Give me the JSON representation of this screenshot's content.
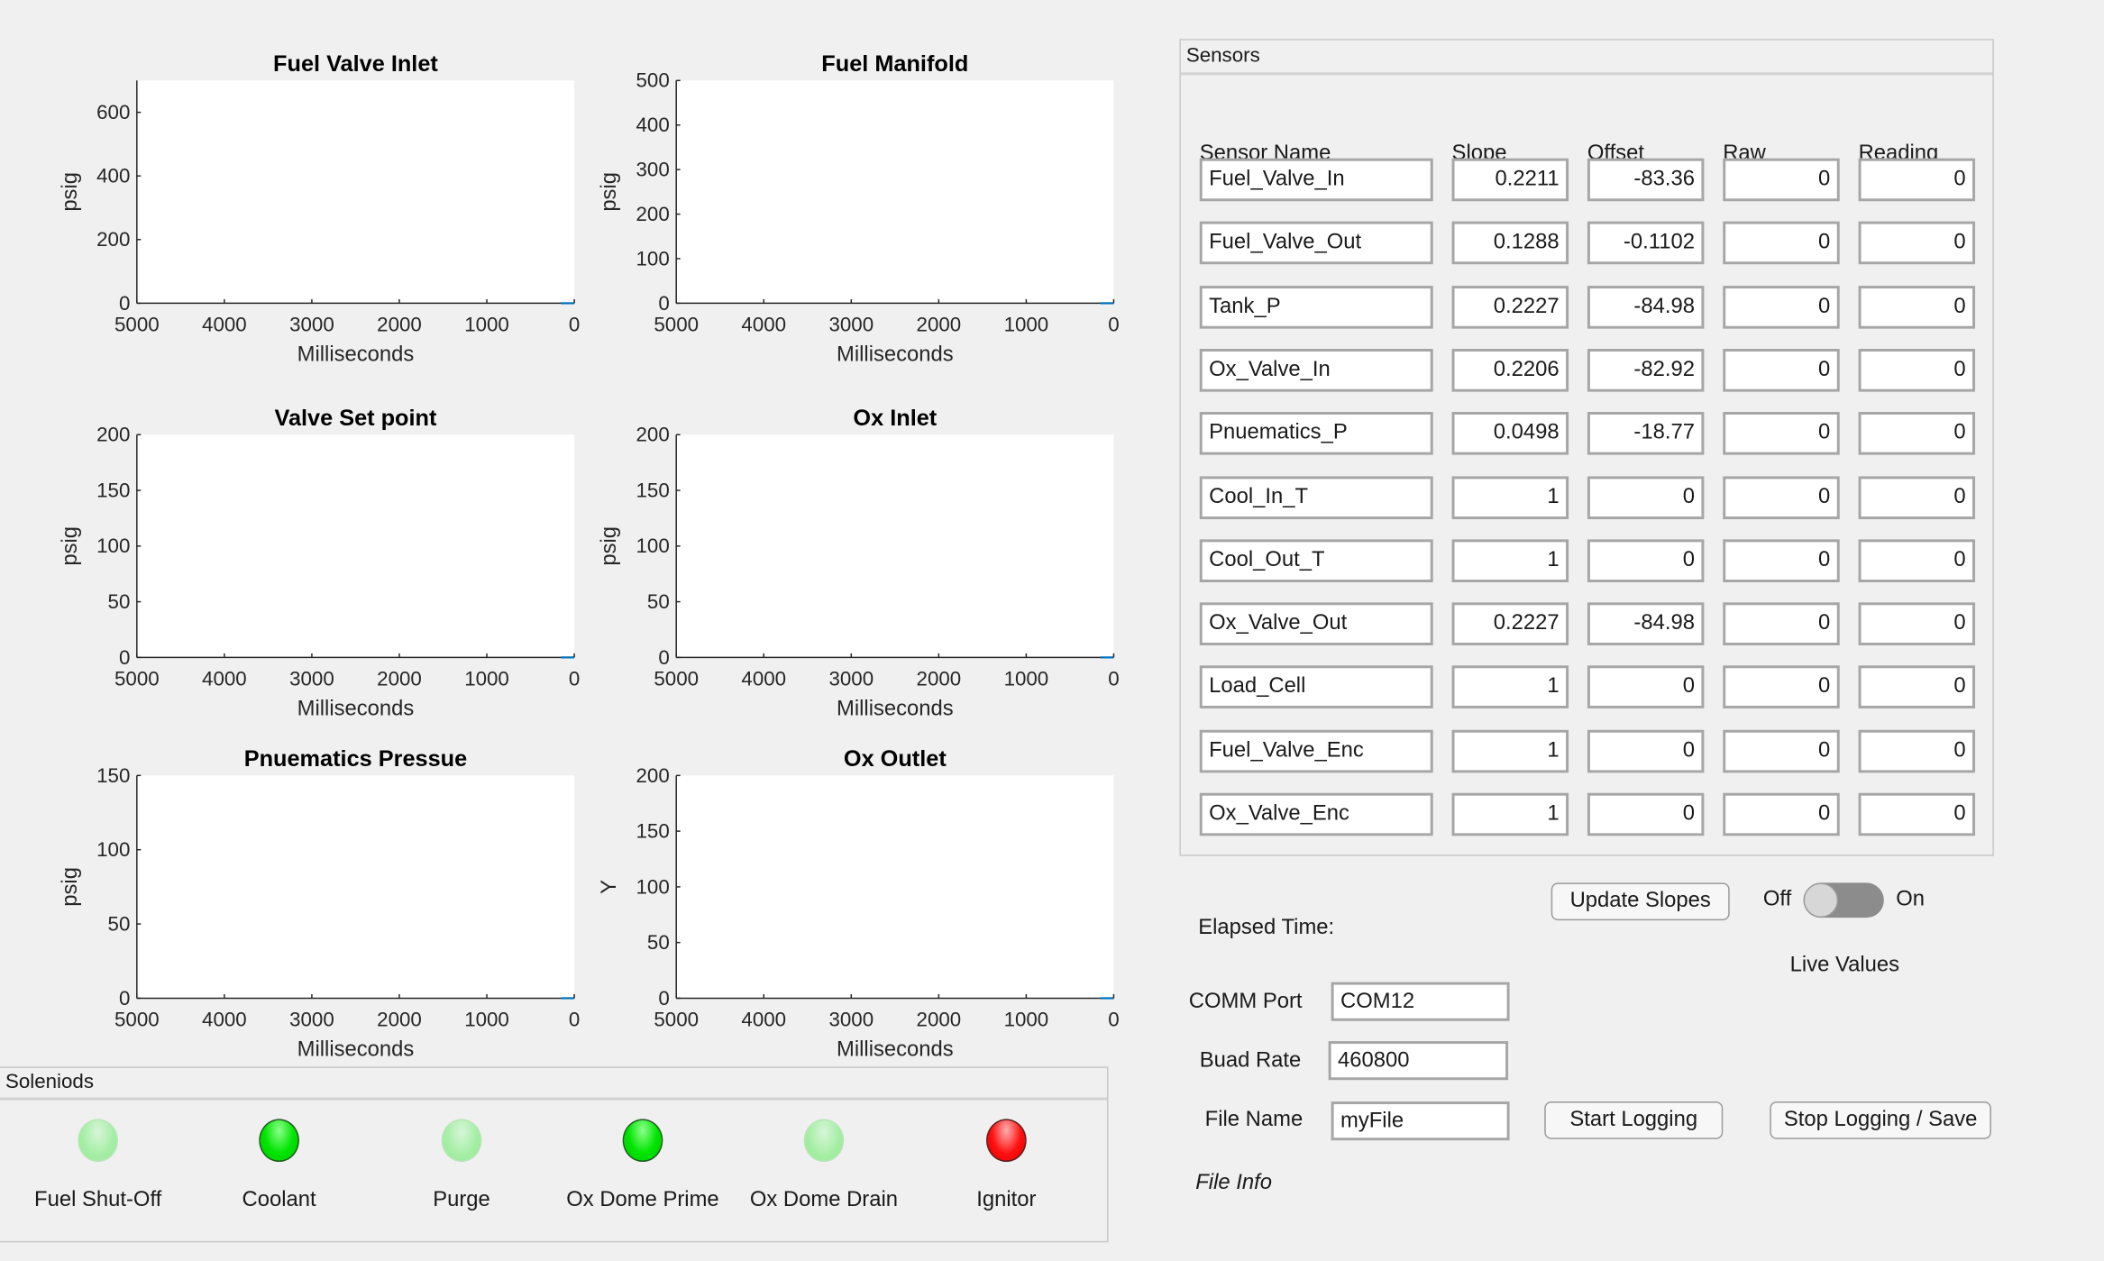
{
  "chart_data": [
    {
      "type": "line",
      "title": "Fuel Valve Inlet",
      "xlabel": "Milliseconds",
      "ylabel": "psig",
      "xlim": [
        5000,
        0
      ],
      "ylim": [
        0,
        700
      ],
      "xticks": [
        5000,
        4000,
        3000,
        2000,
        1000,
        0
      ],
      "yticks": [
        0,
        200,
        400,
        600
      ],
      "series": []
    },
    {
      "type": "line",
      "title": "Fuel Manifold",
      "xlabel": "Milliseconds",
      "ylabel": "psig",
      "xlim": [
        5000,
        0
      ],
      "ylim": [
        0,
        500
      ],
      "xticks": [
        5000,
        4000,
        3000,
        2000,
        1000,
        0
      ],
      "yticks": [
        0,
        100,
        200,
        300,
        400,
        500
      ],
      "series": []
    },
    {
      "type": "line",
      "title": "Valve Set point",
      "xlabel": "Milliseconds",
      "ylabel": "psig",
      "xlim": [
        5000,
        0
      ],
      "ylim": [
        0,
        200
      ],
      "xticks": [
        5000,
        4000,
        3000,
        2000,
        1000,
        0
      ],
      "yticks": [
        0,
        50,
        100,
        150,
        200
      ],
      "series": []
    },
    {
      "type": "line",
      "title": "Ox Inlet",
      "xlabel": "Milliseconds",
      "ylabel": "psig",
      "xlim": [
        5000,
        0
      ],
      "ylim": [
        0,
        200
      ],
      "xticks": [
        5000,
        4000,
        3000,
        2000,
        1000,
        0
      ],
      "yticks": [
        0,
        50,
        100,
        150,
        200
      ],
      "series": []
    },
    {
      "type": "line",
      "title": "Pnuematics Pressue",
      "xlabel": "Milliseconds",
      "ylabel": "psig",
      "xlim": [
        5000,
        0
      ],
      "ylim": [
        0,
        150
      ],
      "xticks": [
        5000,
        4000,
        3000,
        2000,
        1000,
        0
      ],
      "yticks": [
        0,
        50,
        100,
        150
      ],
      "series": []
    },
    {
      "type": "line",
      "title": "Ox Outlet",
      "xlabel": "Milliseconds",
      "ylabel": "Y",
      "xlim": [
        5000,
        0
      ],
      "ylim": [
        0,
        200
      ],
      "xticks": [
        5000,
        4000,
        3000,
        2000,
        1000,
        0
      ],
      "yticks": [
        0,
        50,
        100,
        150,
        200
      ],
      "series": []
    }
  ],
  "sensors": {
    "title": "Sensors",
    "headers": [
      "Sensor Name",
      "Slope",
      "Offset",
      "Raw",
      "Reading"
    ],
    "rows": [
      [
        "Fuel_Valve_In",
        "0.2211",
        "-83.36",
        "0",
        "0"
      ],
      [
        "Fuel_Valve_Out",
        "0.1288",
        "-0.1102",
        "0",
        "0"
      ],
      [
        "Tank_P",
        "0.2227",
        "-84.98",
        "0",
        "0"
      ],
      [
        "Ox_Valve_In",
        "0.2206",
        "-82.92",
        "0",
        "0"
      ],
      [
        "Pnuematics_P",
        "0.0498",
        "-18.77",
        "0",
        "0"
      ],
      [
        "Cool_In_T",
        "1",
        "0",
        "0",
        "0"
      ],
      [
        "Cool_Out_T",
        "1",
        "0",
        "0",
        "0"
      ],
      [
        "Ox_Valve_Out",
        "0.2227",
        "-84.98",
        "0",
        "0"
      ],
      [
        "Load_Cell",
        "1",
        "0",
        "0",
        "0"
      ],
      [
        "Fuel_Valve_Enc",
        "1",
        "0",
        "0",
        "0"
      ],
      [
        "Ox_Valve_Enc",
        "1",
        "0",
        "0",
        "0"
      ]
    ]
  },
  "solenoids": {
    "title": "Soleniods",
    "items": [
      {
        "label": "Fuel Shut-Off",
        "state": "off",
        "color": "#a3eea3"
      },
      {
        "label": "Coolant",
        "state": "on",
        "color": "#00e400"
      },
      {
        "label": "Purge",
        "state": "off",
        "color": "#a3eea3"
      },
      {
        "label": "Ox Dome Prime",
        "state": "on",
        "color": "#00e400"
      },
      {
        "label": "Ox Dome Drain",
        "state": "off",
        "color": "#a3eea3"
      },
      {
        "label": "Ignitor",
        "state": "on",
        "color": "#ff1010"
      }
    ]
  },
  "controls": {
    "elapsed_label": "Elapsed Time:",
    "update_slopes": "Update Slopes",
    "toggle_off": "Off",
    "toggle_on": "On",
    "toggle_state": "Off",
    "live_values": "Live Values",
    "comm_port_label": "COMM Port",
    "comm_port_value": "COM12",
    "baud_label": "Buad Rate",
    "baud_value": "460800",
    "file_name_label": "File Name",
    "file_name_value": "myFile",
    "start_logging": "Start Logging",
    "stop_logging": "Stop Logging / Save",
    "file_info": "File Info"
  }
}
